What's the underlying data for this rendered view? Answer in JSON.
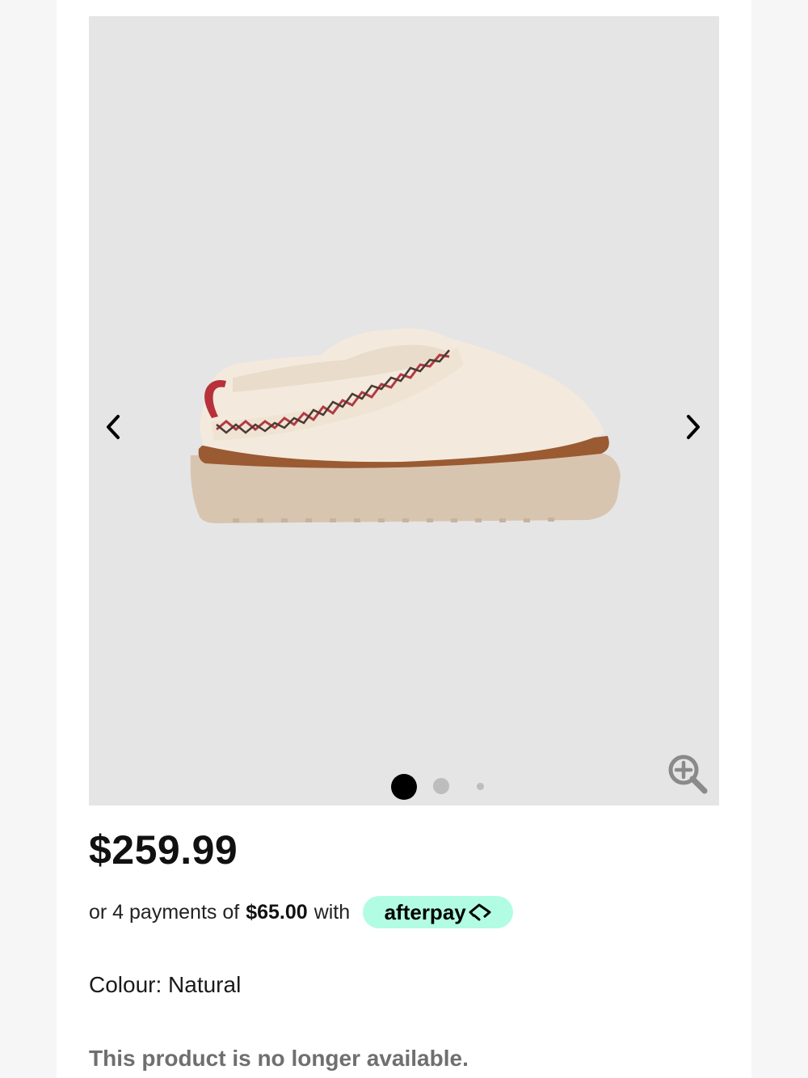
{
  "product": {
    "image_alt": "sheepskin platform slipper, natural colour",
    "price": "$259.99",
    "colour_label": "Colour: Natural",
    "availability": "This product is no longer available."
  },
  "gallery": {
    "prev_icon": "chevron-left-icon",
    "next_icon": "chevron-right-icon",
    "zoom_icon": "zoom-in-icon",
    "slide_count": 3,
    "active_slide": 1
  },
  "payment": {
    "prefix": "or 4 payments of",
    "amount": "$65.00",
    "suffix": "with",
    "provider": "afterpay",
    "provider_color": "#b2fce4"
  }
}
